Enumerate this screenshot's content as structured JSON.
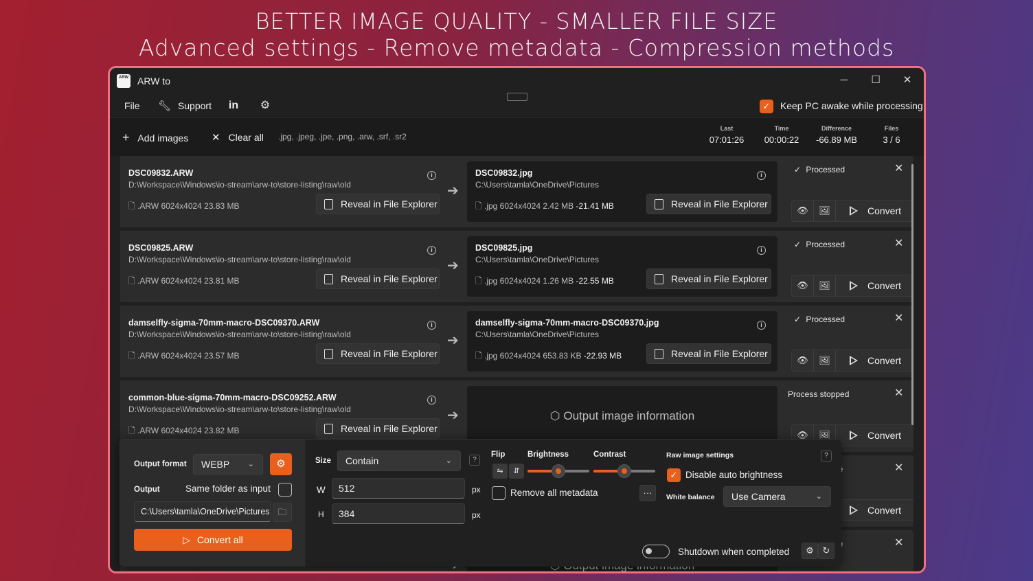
{
  "headline": {
    "line1": "BETTER IMAGE QUALITY - SMALLER FILE SIZE",
    "line2": "Advanced settings - Remove metadata - Compression methods"
  },
  "window": {
    "title": "ARW to",
    "icon_text": "ARW",
    "minimize": "─",
    "maximize": "☐",
    "close": "✕"
  },
  "menu": {
    "file": "File",
    "support": "Support",
    "linkedin": "in",
    "keep_awake_label": "Keep PC awake while processing",
    "keep_awake_checked": true
  },
  "toolbar": {
    "add_images": "Add images",
    "clear_all": "Clear all",
    "extensions": ".jpg, .jpeg, .jpe, .png, .arw, .srf, .sr2",
    "stats": [
      {
        "label": "Last",
        "value": "07:01:26"
      },
      {
        "label": "Time",
        "value": "00:00:22"
      },
      {
        "label": "Difference",
        "value": "-66.89 MB"
      },
      {
        "label": "Files",
        "value": "3 / 6"
      }
    ]
  },
  "reveal_label": "Reveal in File Explorer",
  "convert_label": "Convert",
  "output_placeholder": "Output image information",
  "rows": [
    {
      "in_name": "DSC09832.ARW",
      "in_path": "D:\\Workspace\\Windows\\io-stream\\arw-to\\store-listing\\raw\\old",
      "in_info": ".ARW  6024x4024    23.83 MB",
      "out_name": "DSC09832.jpg",
      "out_path": "C:\\Users\\tamla\\OneDrive\\Pictures",
      "out_info": ".jpg    6024x4024    2.42 MB",
      "out_diff": "-21.41 MB",
      "status": "Processed"
    },
    {
      "in_name": "DSC09825.ARW",
      "in_path": "D:\\Workspace\\Windows\\io-stream\\arw-to\\store-listing\\raw\\old",
      "in_info": ".ARW  6024x4024    23.81 MB",
      "out_name": "DSC09825.jpg",
      "out_path": "C:\\Users\\tamla\\OneDrive\\Pictures",
      "out_info": ".jpg    6024x4024    1.26 MB",
      "out_diff": "-22.55 MB",
      "status": "Processed"
    },
    {
      "in_name": "damselfly-sigma-70mm-macro-DSC09370.ARW",
      "in_path": "D:\\Workspace\\Windows\\io-stream\\arw-to\\store-listing\\raw\\old",
      "in_info": ".ARW  6024x4024    23.57 MB",
      "out_name": "damselfly-sigma-70mm-macro-DSC09370.jpg",
      "out_path": "C:\\Users\\tamla\\OneDrive\\Pictures",
      "out_info": ".jpg    6024x4024    653.83 KB",
      "out_diff": "-22.93 MB",
      "status": "Processed"
    },
    {
      "in_name": "common-blue-sigma-70mm-macro-DSC09252.ARW",
      "in_path": "D:\\Workspace\\Windows\\io-stream\\arw-to\\store-listing\\raw\\old",
      "in_info": ".ARW  6024x4024    23.82 MB",
      "status": "Process stopped"
    }
  ],
  "partial_rows": [
    {
      "status": "ue"
    },
    {
      "status": "ue"
    }
  ],
  "settings": {
    "output_format_label": "Output format",
    "output_format_value": "WEBP",
    "output_label": "Output",
    "same_folder_label": "Same folder as input",
    "output_path": "C:\\Users\\tamla\\OneDrive\\Pictures",
    "convert_all": "Convert all",
    "size_label": "Size",
    "size_value": "Contain",
    "help": "?",
    "w_label": "W",
    "w_value": "512",
    "h_label": "H",
    "h_value": "384",
    "px": "px",
    "flip_label": "Flip",
    "brightness_label": "Brightness",
    "brightness_value": 0.5,
    "contrast_label": "Contrast",
    "contrast_value": 0.5,
    "remove_metadata_label": "Remove all metadata",
    "more": "···",
    "raw_settings_label": "Raw image settings",
    "disable_auto_brightness_label": "Disable auto brightness",
    "white_balance_label": "White balance",
    "white_balance_value": "Use Camera",
    "shutdown_label": "Shutdown when completed"
  }
}
